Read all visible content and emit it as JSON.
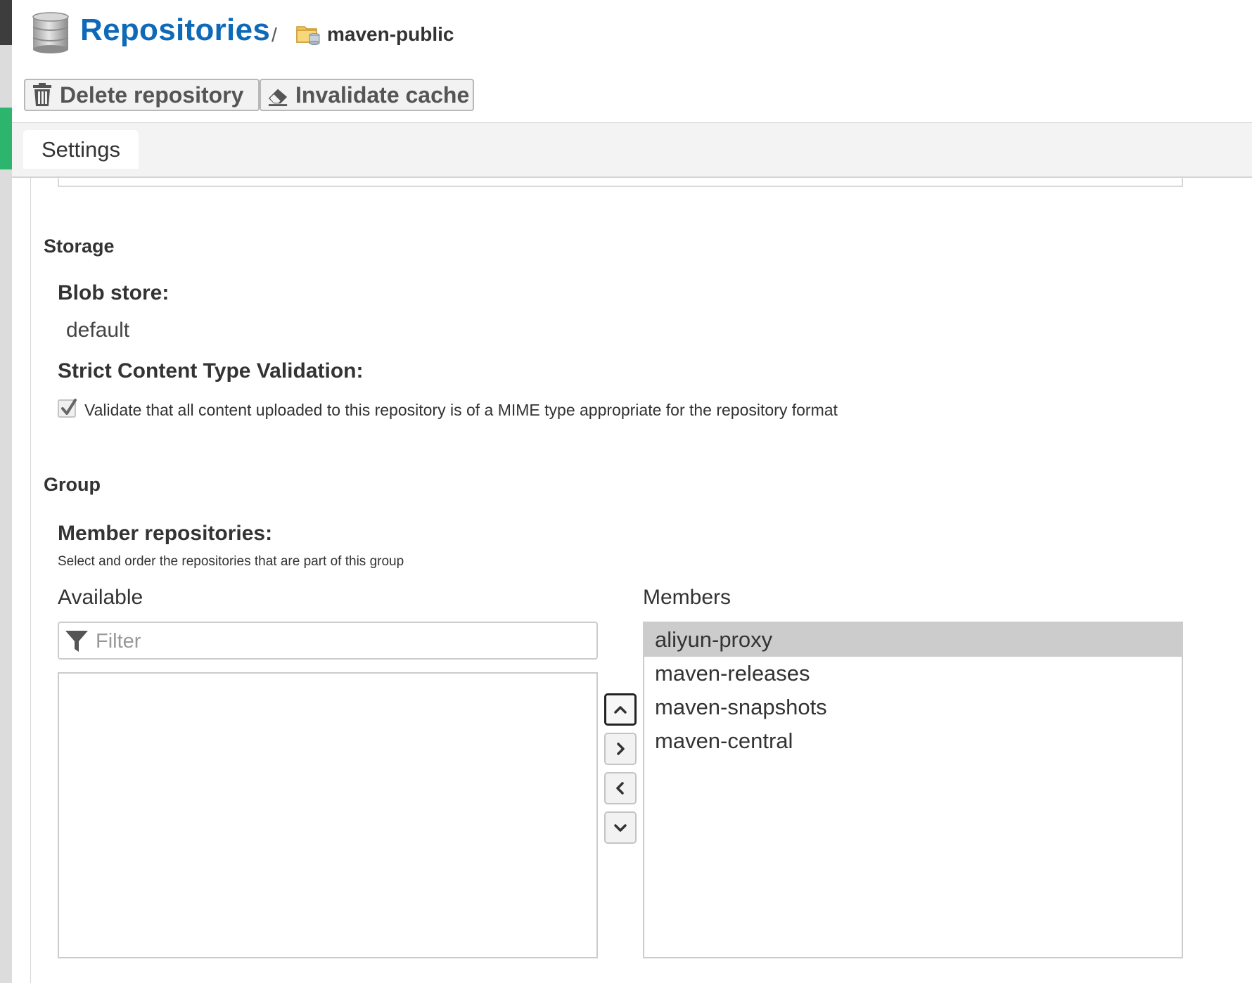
{
  "header": {
    "breadcrumb_root": "Repositories",
    "separator": "/",
    "current_item": "maven-public",
    "root_icon": "database-icon",
    "item_icon": "folder-repository-icon"
  },
  "toolbar": {
    "delete_label": "Delete repository",
    "invalidate_label": "Invalidate cache"
  },
  "tabs": [
    {
      "label": "Settings",
      "active": true
    }
  ],
  "storage": {
    "section_title": "Storage",
    "blob_store_label": "Blob store:",
    "blob_store_value": "default",
    "strict_label": "Strict Content Type Validation:",
    "strict_checked": true,
    "strict_description": "Validate that all content uploaded to this repository is of a MIME type appropriate for the repository format"
  },
  "group": {
    "section_title": "Group",
    "members_label": "Member repositories:",
    "members_help": "Select and order the repositories that are part of this group",
    "available_label": "Available",
    "filter_placeholder": "Filter",
    "available_items": [],
    "members_title": "Members",
    "members": [
      "aliyun-proxy",
      "maven-releases",
      "maven-snapshots",
      "maven-central"
    ],
    "selected_member": "aliyun-proxy"
  },
  "colors": {
    "accent_blue": "#0e6ab8",
    "nav_active_green": "#2db56e",
    "selected_row": "#cccccc"
  }
}
